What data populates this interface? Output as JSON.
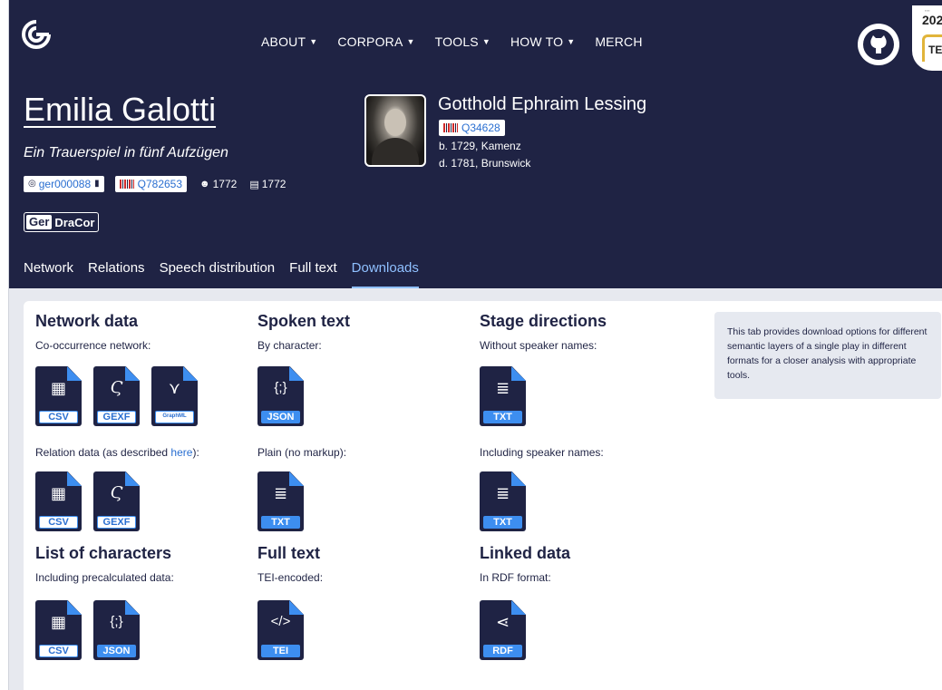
{
  "nav": {
    "items": [
      {
        "label": "ABOUT",
        "dropdown": true
      },
      {
        "label": "CORPORA",
        "dropdown": true
      },
      {
        "label": "TOOLS",
        "dropdown": true
      },
      {
        "label": "HOW TO",
        "dropdown": true
      },
      {
        "label": "MERCH",
        "dropdown": false
      }
    ]
  },
  "tei_badge": {
    "year": "202",
    "label": "TEI"
  },
  "play": {
    "title": "Emilia Galotti",
    "subtitle": "Ein Trauerspiel in fünf Aufzügen",
    "dracor_id": "ger000088",
    "wikidata_id": "Q782653",
    "premiere_year": "1772",
    "print_year": "1772"
  },
  "corpus_badge": {
    "prefix": "Ger",
    "name": "DraCor"
  },
  "author": {
    "name": "Gotthold Ephraim Lessing",
    "wikidata_id": "Q34628",
    "birth": "b. 1729, Kamenz",
    "death": "d. 1781, Brunswick"
  },
  "tabs": [
    {
      "label": "Network",
      "active": false
    },
    {
      "label": "Relations",
      "active": false
    },
    {
      "label": "Speech distribution",
      "active": false
    },
    {
      "label": "Full text",
      "active": false
    },
    {
      "label": "Downloads",
      "active": true
    }
  ],
  "downloads": {
    "network": {
      "heading": "Network data",
      "cooccurrence_label": "Co-occurrence network:",
      "cooccurrence_files": [
        "CSV",
        "GEXF",
        "GraphML"
      ],
      "relation_label_prefix": "Relation data (as described ",
      "relation_label_link": "here",
      "relation_label_suffix": "):",
      "relation_files": [
        "CSV",
        "GEXF"
      ]
    },
    "spoken": {
      "heading": "Spoken text",
      "by_character_label": "By character:",
      "by_character_files": [
        "JSON"
      ],
      "plain_label": "Plain (no markup):",
      "plain_files": [
        "TXT"
      ]
    },
    "stage": {
      "heading": "Stage directions",
      "without_label": "Without speaker names:",
      "without_files": [
        "TXT"
      ],
      "including_label": "Including speaker names:",
      "including_files": [
        "TXT"
      ]
    },
    "characters": {
      "heading": "List of characters",
      "label": "Including precalculated data:",
      "files": [
        "CSV",
        "JSON"
      ]
    },
    "fulltext": {
      "heading": "Full text",
      "label": "TEI-encoded:",
      "files": [
        "TEI"
      ]
    },
    "linked": {
      "heading": "Linked data",
      "label": "In RDF format:",
      "files": [
        "RDF"
      ]
    },
    "info": "This tab provides download options for different semantic layers of a single play in different formats for a closer analysis with appropriate tools."
  },
  "colors": {
    "header_bg": "#1f2344",
    "accent": "#3d8ef0",
    "link": "#2a6fd1",
    "active_tab": "#8fc0ff"
  }
}
